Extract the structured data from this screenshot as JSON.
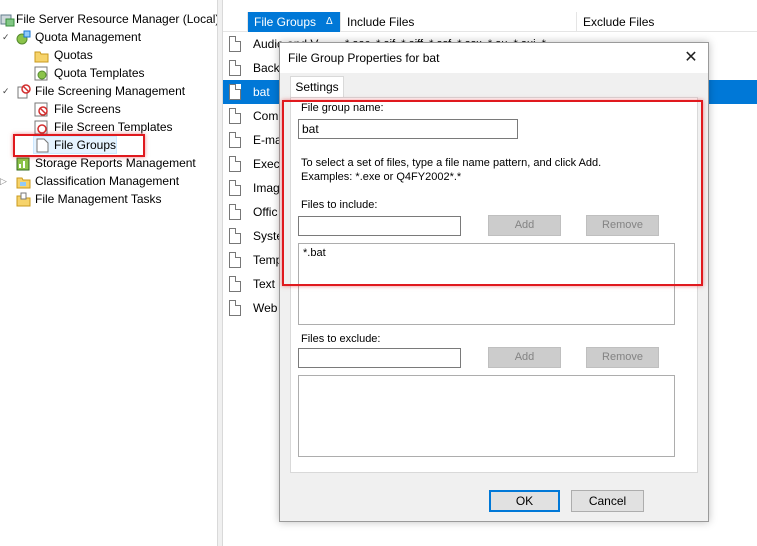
{
  "tree": {
    "items": [
      {
        "label": "File Server Resource Manager (Local)",
        "icon": "fsrm-server-icon"
      },
      {
        "label": "Quota Management",
        "icon": "quota-management-icon"
      },
      {
        "label": "Quotas",
        "icon": "folder-icon"
      },
      {
        "label": "Quota Templates",
        "icon": "quota-template-icon"
      },
      {
        "label": "File Screening Management",
        "icon": "file-screening-icon"
      },
      {
        "label": "File Screens",
        "icon": "file-screen-icon"
      },
      {
        "label": "File Screen Templates",
        "icon": "file-screen-template-icon"
      },
      {
        "label": "File Groups",
        "icon": "document-icon"
      },
      {
        "label": "Storage Reports Management",
        "icon": "storage-reports-icon"
      },
      {
        "label": "Classification Management",
        "icon": "classification-icon"
      },
      {
        "label": "File Management Tasks",
        "icon": "file-management-tasks-icon"
      }
    ]
  },
  "list": {
    "columns": [
      "File Groups",
      "Include Files",
      "Exclude Files"
    ],
    "sort_indicator": "Δ",
    "rows": [
      "Audio and V",
      "Back",
      "bat",
      "Com",
      "E-ma",
      "Exec",
      "Imag",
      "Offic",
      "Syste",
      "Temp",
      "Text",
      "Web"
    ],
    "row0_include_fragment": "*.aac, *.aif, *.aiff, *.asf, *.asx, *.au, *.aui, *"
  },
  "dialog": {
    "title": "File Group Properties for bat",
    "close_glyph": "✕",
    "tab": "Settings",
    "name_label": "File group name:",
    "name_value": "bat",
    "instructions": "To select a set of files, type a file name pattern, and click Add.",
    "examples": "Examples: *.exe or Q4FY2002*.*",
    "include_label": "Files to include:",
    "include_input": "",
    "add_label": "Add",
    "remove_label": "Remove",
    "include_list": [
      "*.bat"
    ],
    "exclude_label": "Files to exclude:",
    "exclude_input": "",
    "exclude_list": [],
    "ok_label": "OK",
    "cancel_label": "Cancel"
  },
  "colors": {
    "selection": "#0078d7",
    "highlight_box": "#e0191e"
  }
}
